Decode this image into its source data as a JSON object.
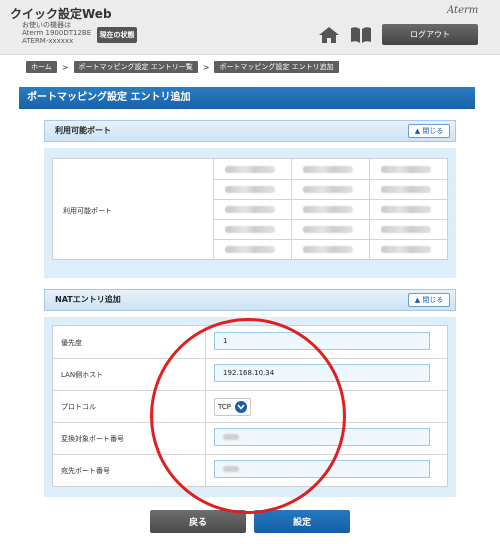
{
  "header": {
    "app_title": "クイック設定Web",
    "device_caption": "お使いの機器は",
    "device_model": "Aterm 1900DT12BE",
    "device_ssid": "ATERM-xxxxxx",
    "status_button": "現在の状態",
    "brand": "Aterm",
    "logout_button": "ログアウト",
    "icons": [
      "home-icon",
      "book-icon"
    ]
  },
  "breadcrumb": {
    "items": [
      "ホーム",
      "ポートマッピング設定 エントリ一覧",
      "ポートマッピング設定 エントリ追加"
    ],
    "separator": ">"
  },
  "page_title": "ポートマッピング設定 エントリ追加",
  "available_ports": {
    "header": "利用可能ポート",
    "toggle": "閉じる",
    "row_label": "利用可能ポート",
    "note": "port values are blurred/obscured in the screenshot"
  },
  "nat": {
    "header": "NATエントリ追加",
    "toggle": "閉じる",
    "fields": [
      {
        "label": "優先度",
        "value": "1"
      },
      {
        "label": "LAN側ホスト",
        "value": "192.168.10.34"
      },
      {
        "label": "プロトコル",
        "value": "TCP"
      },
      {
        "label": "変換対象ポート番号",
        "value": ""
      },
      {
        "label": "宛先ポート番号",
        "value": ""
      }
    ]
  },
  "buttons": {
    "back": "戻る",
    "set": "設定"
  },
  "colors": {
    "accent_blue": "#1a5fa6",
    "annotation_red": "#e01f1f",
    "section_bg": "#dceefa"
  }
}
